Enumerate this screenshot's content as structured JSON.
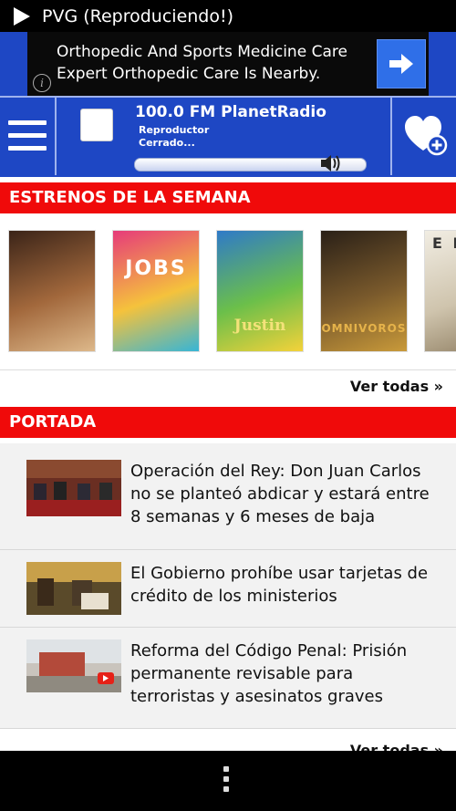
{
  "statusbar": {
    "title": "PVG (Reproduciendo!)",
    "icon": "play-icon"
  },
  "ad": {
    "line1": "Orthopedic And Sports Medicine Care",
    "line2": "Expert Orthopedic Care Is Nearby.",
    "info_glyph": "i",
    "go_icon": "arrow-right-icon"
  },
  "player": {
    "station": "100.0 FM PlanetRadio",
    "status": "Reproductor Cerrado...",
    "volume_fraction": 0.85,
    "menu_icon": "hamburger-icon",
    "favorite_icon": "heart-plus-icon",
    "volume_icon": "speaker-icon"
  },
  "premieres": {
    "header": "ESTRENOS DE LA SEMANA",
    "movies": [
      {
        "title": "",
        "colors": [
          "#3b2418",
          "#a2683c",
          "#ddb88a"
        ]
      },
      {
        "title": "JOBS",
        "colors": [
          "#e63b7a",
          "#f5c23c",
          "#37b5d6"
        ]
      },
      {
        "title": "Justin",
        "colors": [
          "#2f7ac8",
          "#6bbf4a",
          "#f4d23a"
        ]
      },
      {
        "title": "OMNIVOROS",
        "colors": [
          "#2a2017",
          "#7a5a2c",
          "#c99a3a"
        ]
      },
      {
        "title": "E L",
        "colors": [
          "#f1ede3",
          "#cfc4ad",
          "#8c7b5e"
        ]
      }
    ],
    "see_all": "Ver todas »"
  },
  "front_page": {
    "header": "PORTADA",
    "items": [
      {
        "headline": "Operación del Rey: Don Juan Carlos no se planteó abdicar y estará entre 8 semanas y 6 meses de baja"
      },
      {
        "headline": "El Gobierno prohíbe usar tarjetas de crédito de los ministerios"
      },
      {
        "headline": "Reforma del Código Penal: Prisión permanente revisable para terroristas y asesinatos graves"
      }
    ],
    "see_all": "Ver todas »"
  },
  "navbar": {
    "menu_icon": "overflow-menu-icon"
  }
}
